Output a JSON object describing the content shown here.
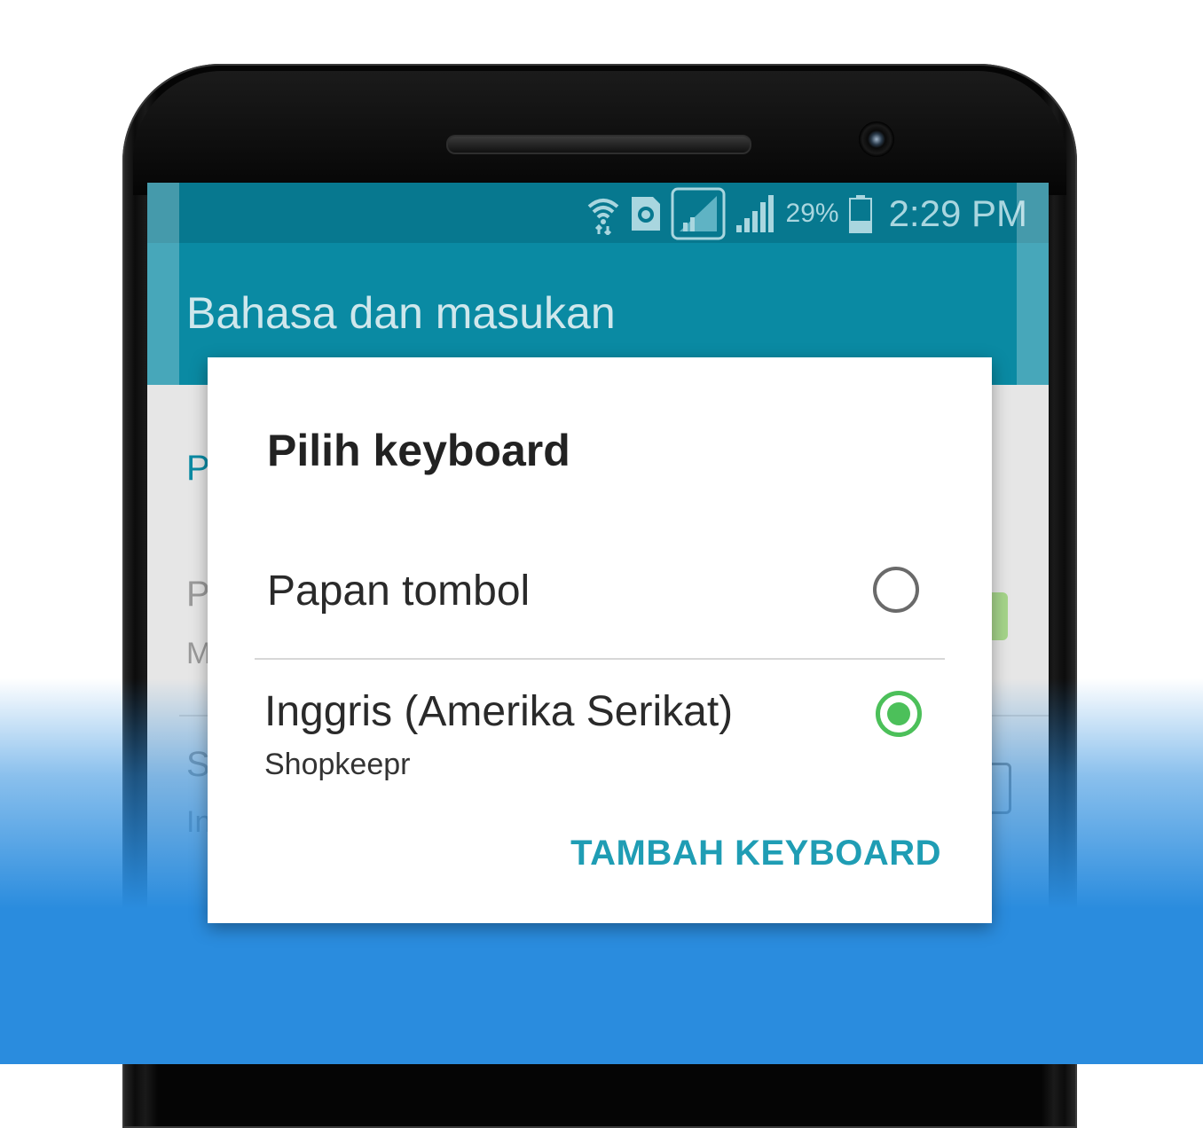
{
  "status_bar": {
    "battery_percent": "29%",
    "time": "2:29 PM",
    "icons": [
      "wifi-icon",
      "sim-icon",
      "signal-icon",
      "signal-icon",
      "battery-icon"
    ]
  },
  "screen": {
    "title": "Bahasa dan masukan",
    "background_items": [
      "P",
      "P",
      "M",
      "S",
      "In"
    ]
  },
  "dialog": {
    "title": "Pilih keyboard",
    "options": [
      {
        "label": "Papan tombol",
        "sublabel": "",
        "selected": false
      },
      {
        "label": "Inggris (Amerika Serikat)",
        "sublabel": "Shopkeepr",
        "selected": true
      }
    ],
    "action_label": "TAMBAH KEYBOARD"
  },
  "colors": {
    "accent": "#1f9db4",
    "header": "#0a8aa3",
    "radio_selected": "#4cc05a",
    "background_blue": "#2a8cde"
  }
}
